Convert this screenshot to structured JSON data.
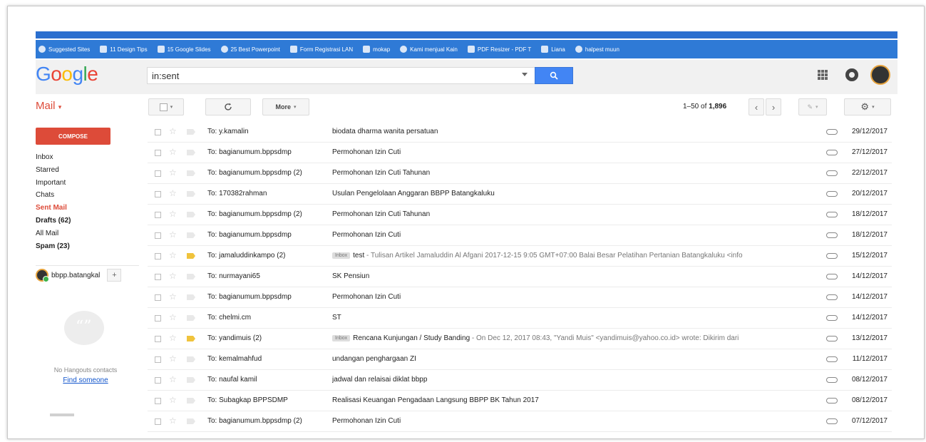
{
  "bookmarks_bar": {
    "items": [
      {
        "label": "Suggested Sites"
      },
      {
        "label": "11 Design Tips"
      },
      {
        "label": "15 Google Slides"
      },
      {
        "label": "25 Best Powerpoint"
      },
      {
        "label": "Form Registrasi LAN"
      },
      {
        "label": "mokap"
      },
      {
        "label": "Kami menjual Kain"
      },
      {
        "label": "PDF Resizer - PDF T"
      },
      {
        "label": "Liana"
      },
      {
        "label": "halpest muun"
      }
    ]
  },
  "header": {
    "logo_letters": [
      "G",
      "o",
      "o",
      "g",
      "l",
      "e"
    ],
    "search_value": "in:sent",
    "icons": [
      "apps-icon",
      "notifications-icon",
      "account-avatar"
    ]
  },
  "toolbar": {
    "mail_label": "Mail",
    "more_label": "More",
    "count_prefix": "1–50 of",
    "count_total": "1,896"
  },
  "sidebar": {
    "compose_label": "COMPOSE",
    "nav": [
      {
        "label": "Inbox",
        "style": ""
      },
      {
        "label": "Starred",
        "style": ""
      },
      {
        "label": "Important",
        "style": ""
      },
      {
        "label": "Chats",
        "style": ""
      },
      {
        "label": "Sent Mail",
        "style": "active"
      },
      {
        "label": "Drafts (62)",
        "style": "bold"
      },
      {
        "label": "All Mail",
        "style": ""
      },
      {
        "label": "Spam (23)",
        "style": "bold"
      }
    ],
    "hangouts_user": "bbpp.batangkal",
    "hangouts_empty": "No Hangouts contacts",
    "find_someone": "Find someone"
  },
  "emails": [
    {
      "to": "To: y.kamalin",
      "label": "",
      "subject": "biodata dharma wanita persatuan",
      "snippet": "",
      "important": false,
      "date": "29/12/2017"
    },
    {
      "to": "To: bagianumum.bppsdmp",
      "label": "",
      "subject": "Permohonan Izin Cuti",
      "snippet": "",
      "important": false,
      "date": "27/12/2017"
    },
    {
      "to": "To: bagianumum.bppsdmp (2)",
      "label": "",
      "subject": "Permohonan Izin Cuti Tahunan",
      "snippet": "",
      "important": false,
      "date": "22/12/2017"
    },
    {
      "to": "To: 170382rahman",
      "label": "",
      "subject": "Usulan Pengelolaan Anggaran BBPP Batangkaluku",
      "snippet": "",
      "important": false,
      "date": "20/12/2017"
    },
    {
      "to": "To: bagianumum.bppsdmp (2)",
      "label": "",
      "subject": "Permohonan Izin Cuti Tahunan",
      "snippet": "",
      "important": false,
      "date": "18/12/2017"
    },
    {
      "to": "To: bagianumum.bppsdmp",
      "label": "",
      "subject": "Permohonan Izin Cuti",
      "snippet": "",
      "important": false,
      "date": "18/12/2017"
    },
    {
      "to": "To: jamaluddinkampo (2)",
      "label": "Inbox",
      "subject": "test",
      "snippet": " - Tulisan Artikel Jamaluddin Al Afgani 2017-12-15 9:05 GMT+07:00 Balai Besar Pelatihan Pertanian Batangkaluku <info",
      "important": true,
      "date": "15/12/2017"
    },
    {
      "to": "To: nurmayani65",
      "label": "",
      "subject": "SK Pensiun",
      "snippet": "",
      "important": false,
      "date": "14/12/2017"
    },
    {
      "to": "To: bagianumum.bppsdmp",
      "label": "",
      "subject": "Permohonan Izin Cuti",
      "snippet": "",
      "important": false,
      "date": "14/12/2017"
    },
    {
      "to": "To: chelmi.cm",
      "label": "",
      "subject": "ST",
      "snippet": "",
      "important": false,
      "date": "14/12/2017"
    },
    {
      "to": "To: yandimuis (2)",
      "label": "Inbox",
      "subject": "Rencana Kunjungan / Study Banding",
      "snippet": " - On Dec 12, 2017 08:43, \"Yandi Muis\" <yandimuis@yahoo.co.id> wrote: Dikirim dari",
      "important": true,
      "date": "13/12/2017"
    },
    {
      "to": "To: kemalmahfud",
      "label": "",
      "subject": "undangan penghargaan ZI",
      "snippet": "",
      "important": false,
      "date": "11/12/2017"
    },
    {
      "to": "To: naufal kamil",
      "label": "",
      "subject": "jadwal dan relaisai diklat bbpp",
      "snippet": "",
      "important": false,
      "date": "08/12/2017"
    },
    {
      "to": "To: Subagkap BPPSDMP",
      "label": "",
      "subject": "Realisasi Keuangan Pengadaan Langsung BBPP BK Tahun 2017",
      "snippet": "",
      "important": false,
      "date": "08/12/2017"
    },
    {
      "to": "To: bagianumum.bppsdmp (2)",
      "label": "",
      "subject": "Permohonan Izin Cuti",
      "snippet": "",
      "important": false,
      "date": "07/12/2017"
    }
  ]
}
